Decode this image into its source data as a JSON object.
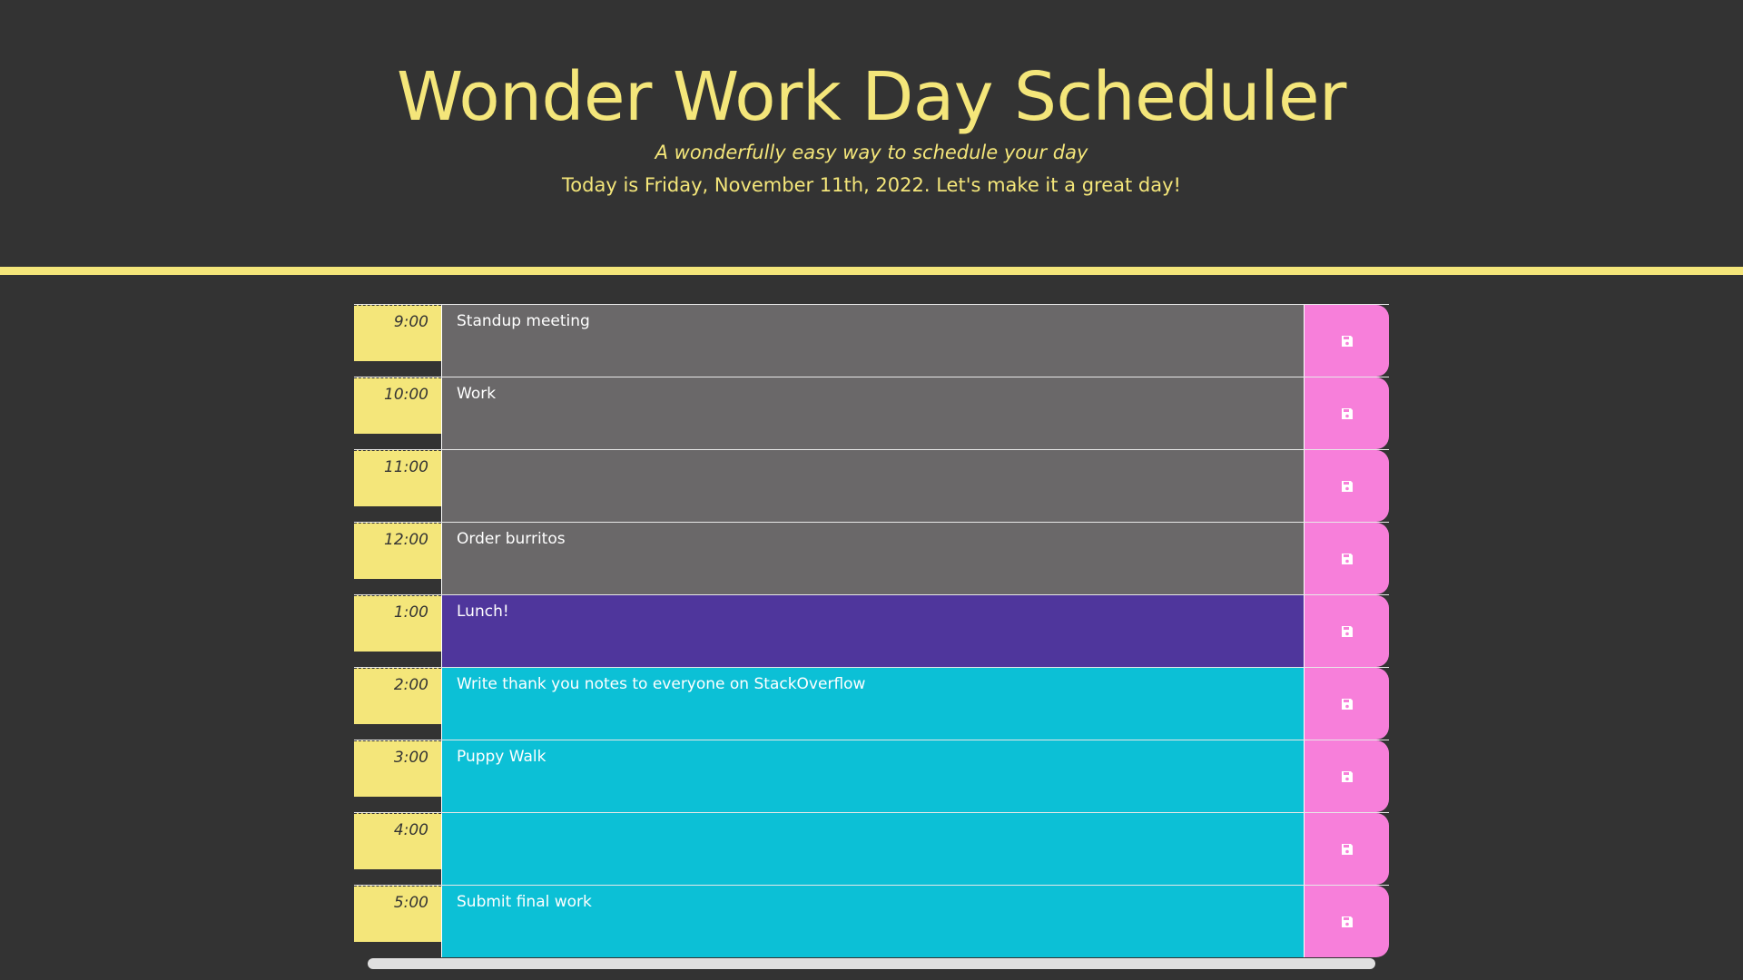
{
  "header": {
    "title": "Wonder Work Day Scheduler",
    "tagline": "A wonderfully easy way to schedule your day",
    "today": "Today is Friday, November 11th, 2022. Let's make it a great day!"
  },
  "colors": {
    "accent": "#f4e67a",
    "background": "#333333",
    "past": "#6a6869",
    "present": "#4f369c",
    "future": "#0cc0d6",
    "save": "#f77fda"
  },
  "rows": [
    {
      "hour": "9:00",
      "task": "Standup meeting",
      "state": "past"
    },
    {
      "hour": "10:00",
      "task": "Work",
      "state": "past"
    },
    {
      "hour": "11:00",
      "task": "",
      "state": "past"
    },
    {
      "hour": "12:00",
      "task": "Order burritos",
      "state": "past"
    },
    {
      "hour": "1:00",
      "task": "Lunch!",
      "state": "present"
    },
    {
      "hour": "2:00",
      "task": "Write thank you notes to everyone on StackOverflow",
      "state": "future"
    },
    {
      "hour": "3:00",
      "task": "Puppy Walk",
      "state": "future"
    },
    {
      "hour": "4:00",
      "task": "",
      "state": "future"
    },
    {
      "hour": "5:00",
      "task": "Submit final work",
      "state": "future"
    }
  ],
  "save_icon": "floppy-disk-icon"
}
